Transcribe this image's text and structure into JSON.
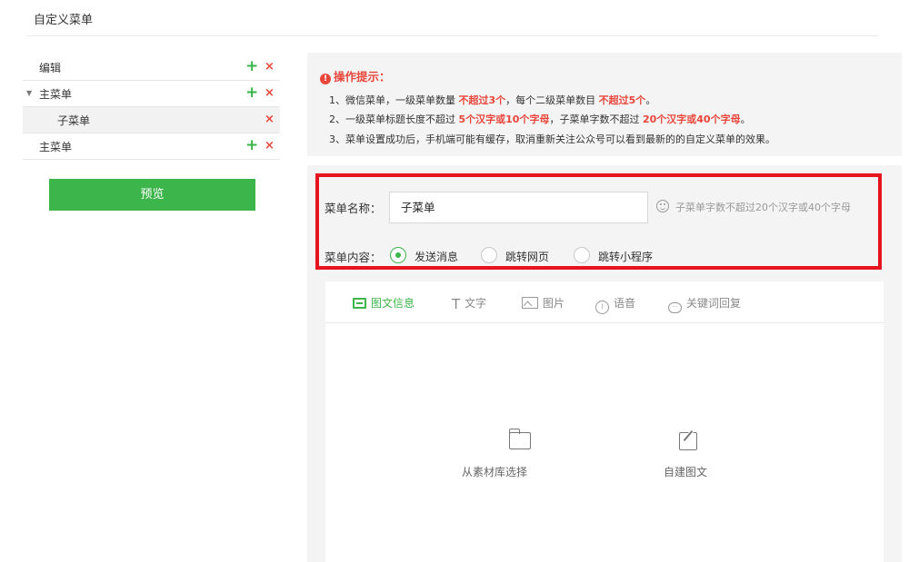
{
  "page": {
    "title": "自定义菜单"
  },
  "menu_tree": [
    {
      "label": "编辑",
      "has_add": true,
      "has_delete": true
    },
    {
      "label": "主菜单",
      "expanded": true,
      "has_add": true,
      "has_delete": true
    },
    {
      "label": "子菜单",
      "has_add": false,
      "has_delete": true,
      "selected": true
    },
    {
      "label": "主菜单",
      "has_add": true,
      "has_delete": true
    }
  ],
  "icons": {
    "add": "+",
    "delete": "×",
    "caret": "▼",
    "alert": "!"
  },
  "preview_button": "预览",
  "tips": {
    "heading": "操作提示：",
    "line1_a": "1、微信菜单，一级菜单数量 ",
    "line1_b": "不超过3个",
    "line1_c": "，每个二级菜单数目 ",
    "line1_d": "不超过5个",
    "line1_e": "。",
    "line2_a": "2、一级菜单标题长度不超过 ",
    "line2_b": "5个汉字或10个字母",
    "line2_c": "，子菜单字数不超过 ",
    "line2_d": "20个汉字或40个字母",
    "line2_e": "。",
    "line3": "3、菜单设置成功后，手机端可能有缓存，取消重新关注公众号可以看到最新的的自定义菜单的效果。"
  },
  "form": {
    "name_label": "菜单名称：",
    "name_value": "子菜单",
    "name_hint": "子菜单字数不超过20个汉字或40个字母",
    "content_label": "菜单内容：",
    "options": [
      {
        "label": "发送消息",
        "checked": true
      },
      {
        "label": "跳转网页",
        "checked": false
      },
      {
        "label": "跳转小程序",
        "checked": false
      }
    ]
  },
  "message_tabs": [
    {
      "label": "图文信息",
      "icon": "news-icon",
      "active": true
    },
    {
      "label": "文字",
      "icon": "text-icon",
      "active": false
    },
    {
      "label": "图片",
      "icon": "image-icon",
      "active": false
    },
    {
      "label": "语音",
      "icon": "voice-icon",
      "active": false
    },
    {
      "label": "关键词回复",
      "icon": "chat-icon",
      "active": false
    }
  ],
  "message_actions": {
    "from_library": "从素材库选择",
    "create_news": "自建图文"
  },
  "colors": {
    "accent": "#3cb54a",
    "danger": "#e8463b",
    "highlight": "#e6141e"
  }
}
